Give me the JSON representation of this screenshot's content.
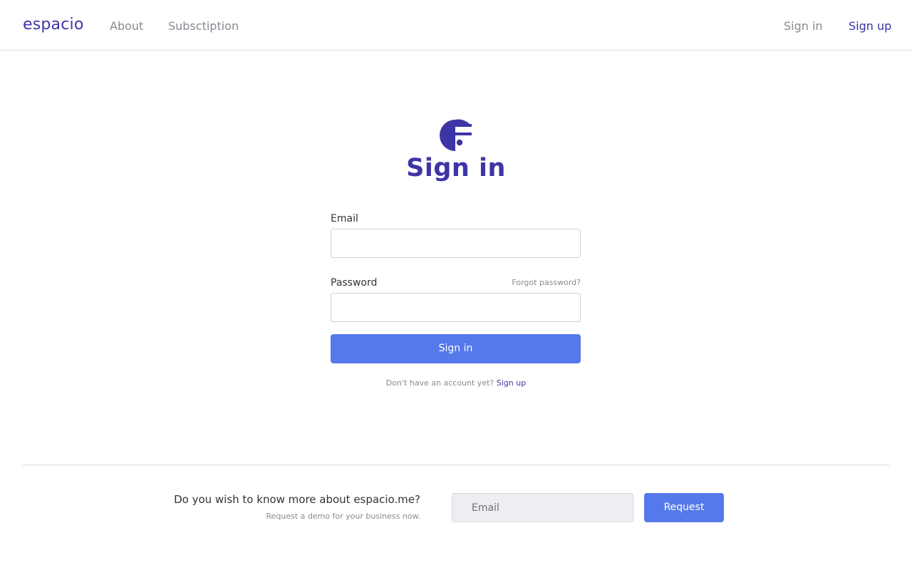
{
  "header": {
    "brand": "espacio",
    "nav": {
      "about": "About",
      "subscription": "Subsctiption"
    },
    "auth": {
      "sign_in": "Sign in",
      "sign_up": "Sign up"
    }
  },
  "logo_icon": "espacio-f-logo-icon",
  "signin": {
    "title": "Sign in",
    "email_label": "Email",
    "email_value": "",
    "password_label": "Password",
    "password_value": "",
    "forgot_password": "Forgot password?",
    "submit_label": "Sign in",
    "no_account_text": "Don't have an account yet?",
    "sign_up_link": "Sign up"
  },
  "footer": {
    "heading": "Do you wish to know more about espacio.me?",
    "subheading": "Request a demo for your business now.",
    "email_placeholder": "Email",
    "request_label": "Request"
  },
  "colors": {
    "brand": "#3d35a6",
    "button": "#5578ea",
    "muted": "#8a8a92",
    "border": "#e2e2e6"
  }
}
